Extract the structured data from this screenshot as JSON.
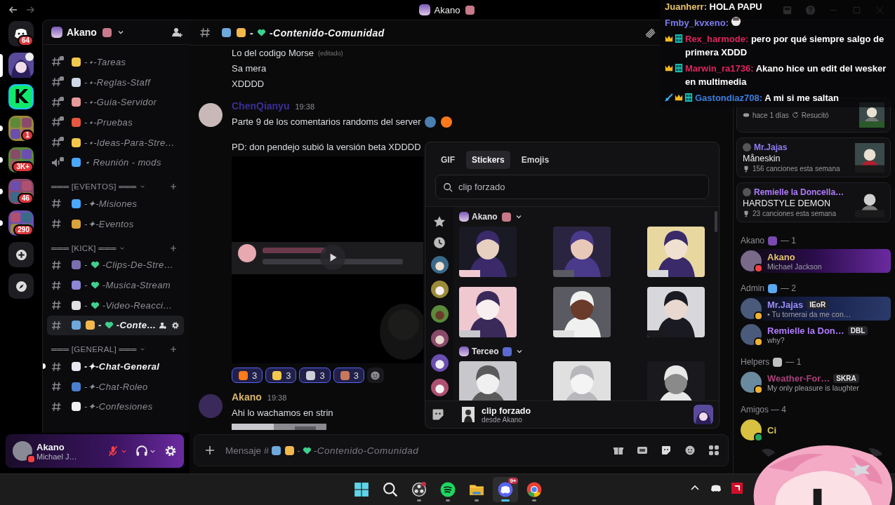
{
  "titlebar": {
    "title": "Akano",
    "title_emoji": {
      "color": "#c87a8a"
    }
  },
  "servers": [
    {
      "kind": "home",
      "badge": "64",
      "selected": false,
      "unread": false
    },
    {
      "kind": "server",
      "selected": true,
      "unread": false,
      "voice": true
    },
    {
      "kind": "logo",
      "letter": "K",
      "selected": false,
      "unread": false
    },
    {
      "kind": "folder",
      "badge": "1",
      "selected": false,
      "unread": true
    },
    {
      "kind": "folder",
      "badge": "3K+",
      "selected": false,
      "unread": true
    },
    {
      "kind": "folder",
      "badge": "46",
      "selected": false,
      "unread": true
    },
    {
      "kind": "folder",
      "badge": "290",
      "selected": false,
      "unread": true
    },
    {
      "kind": "add",
      "selected": false,
      "unread": false
    },
    {
      "kind": "discover",
      "selected": false,
      "unread": false
    }
  ],
  "channel_panel": {
    "server": "Akano",
    "server_emoji": {
      "color": "#c87a8a"
    },
    "items": [
      {
        "kind": "text",
        "locked": true,
        "emojis": [
          {
            "color": "#f2c94c"
          }
        ],
        "name": "-⋆-Tareas",
        "selected": false,
        "unread": false
      },
      {
        "kind": "text",
        "locked": true,
        "emojis": [
          {
            "color": "#cfd8e6"
          }
        ],
        "name": "-⋆-Reglas-Staff",
        "selected": false,
        "unread": false
      },
      {
        "kind": "text",
        "locked": true,
        "emojis": [
          {
            "color": "#e89a9a"
          }
        ],
        "name": "-⋆-Guia-Servidor",
        "selected": false,
        "unread": false
      },
      {
        "kind": "text",
        "locked": true,
        "emojis": [
          {
            "color": "#e8563f"
          }
        ],
        "name": "-⋆-Pruebas",
        "selected": false,
        "unread": false
      },
      {
        "kind": "text",
        "locked": true,
        "emojis": [
          {
            "color": "#f5c84a"
          }
        ],
        "name": "-⋆-Ideas-Para-Stre…",
        "selected": false,
        "unread": false
      },
      {
        "kind": "voice",
        "locked": true,
        "emojis": [
          {
            "color": "#4aa8ff"
          }
        ],
        "name": "⋆ Reunión - mods",
        "selected": false,
        "unread": false
      },
      {
        "kind": "category",
        "label": "═══ [EVENTOS] ═══"
      },
      {
        "kind": "text",
        "locked": false,
        "emojis": [
          {
            "color": "#4aa8ff"
          }
        ],
        "name": "-✦-Misiones",
        "selected": false,
        "unread": false
      },
      {
        "kind": "text",
        "locked": false,
        "emojis": [
          {
            "color": "#d9a23a"
          }
        ],
        "name": "-✦-Eventos",
        "selected": false,
        "unread": false
      },
      {
        "kind": "category",
        "label": "═══ [KICK] ═══"
      },
      {
        "kind": "text",
        "locked": false,
        "emojis": [
          {
            "color": "#7b6fb0"
          }
        ],
        "prefix": "-",
        "heart": true,
        "name": "-Clips-De-Stre…",
        "selected": false,
        "unread": false
      },
      {
        "kind": "text",
        "locked": false,
        "emojis": [
          {
            "color": "#8e86d8"
          }
        ],
        "prefix": "-",
        "heart": true,
        "name": "-Musica-Stream",
        "selected": false,
        "unread": false
      },
      {
        "kind": "text",
        "locked": false,
        "emojis": [
          {
            "color": "#e0e0e0"
          }
        ],
        "prefix": "-",
        "heart": true,
        "name": "-Video-Reacci…",
        "selected": false,
        "unread": false
      },
      {
        "kind": "text",
        "locked": false,
        "emojis": [
          {
            "color": "#6fa8dc"
          },
          {
            "color": "#f2b84b"
          }
        ],
        "prefix": "-",
        "heart": true,
        "name": "-Conte…",
        "selected": true,
        "unread": false
      },
      {
        "kind": "category",
        "label": "═══ [GENERAL] ═══"
      },
      {
        "kind": "text",
        "locked": false,
        "emojis": [
          {
            "color": "#e8e8f0"
          }
        ],
        "name": "-✦-Chat-General",
        "selected": false,
        "unread": true
      },
      {
        "kind": "text",
        "locked": false,
        "emojis": [
          {
            "color": "#4a7fd0"
          }
        ],
        "name": "-✦-Chat-Roleo",
        "selected": false,
        "unread": false
      },
      {
        "kind": "text",
        "locked": false,
        "emojis": [
          {
            "color": "#f0f0f0"
          }
        ],
        "name": "-✦-Confesiones",
        "selected": false,
        "unread": false
      }
    ]
  },
  "user_panel": {
    "name": "Akano",
    "activity": "Michael J…",
    "muted": true
  },
  "chat": {
    "header": {
      "emojis": [
        {
          "color": "#6fa8dc"
        },
        {
          "color": "#f2b84b"
        }
      ],
      "prefix": "-",
      "heart": true,
      "channel": "-Contenido-Comunidad"
    },
    "messages": [
      {
        "kind": "tail",
        "lines": [
          {
            "text": "Lo del codigo Morse",
            "note": "(editado)"
          },
          {
            "text": "Sa mera"
          },
          {
            "text": "XDDDD"
          }
        ]
      },
      {
        "kind": "message",
        "author": "ChenQianyu",
        "color": "#3b2f9a",
        "time": "19:38",
        "lines": [
          {
            "text": "Parte 9 de los comentarios randoms del server",
            "emojis": [
              {
                "color": "#4a7fb0"
              },
              {
                "color": "#ff7a1a"
              }
            ]
          },
          {
            "text": "PD: don pendejo subió la versión beta XDDDD",
            "gap": true
          }
        ],
        "video": true,
        "reactions": [
          {
            "emoji": {
              "color": "#ff7a1a"
            },
            "count": "3",
            "selected": true
          },
          {
            "emoji": {
              "color": "#f2c94c"
            },
            "count": "3",
            "selected": true
          },
          {
            "emoji": {
              "color": "#cfcfd8"
            },
            "count": "3",
            "selected": true
          },
          {
            "emoji": {
              "color": "#c8785a"
            },
            "count": "3",
            "selected": true
          }
        ]
      },
      {
        "kind": "message",
        "author": "Akano",
        "color": "#d9b46a",
        "time": "19:38",
        "lines": [
          {
            "text": "Ahi lo wachamos en strin"
          }
        ],
        "image": true
      }
    ],
    "composer": {
      "placeholder": "Mensaje #",
      "emojis": [
        {
          "color": "#6fa8dc"
        },
        {
          "color": "#f2b84b"
        }
      ],
      "prefix": "-",
      "heart": true,
      "channel": "-Contenido-Comunidad"
    }
  },
  "picker": {
    "tabs": [
      {
        "label": "GIF",
        "selected": false
      },
      {
        "label": "Stickers",
        "selected": true
      },
      {
        "label": "Emojis",
        "selected": false
      }
    ],
    "search": {
      "value": "clip forzado"
    },
    "packs": [
      {
        "kind": "favorites"
      },
      {
        "kind": "recent"
      },
      {
        "kind": "picture"
      },
      {
        "kind": "picture"
      },
      {
        "kind": "picture"
      },
      {
        "kind": "picture"
      },
      {
        "kind": "picture"
      },
      {
        "kind": "picture"
      }
    ],
    "sections": [
      {
        "name": "Akano",
        "emoji": {
          "color": "#c87a8a"
        },
        "expanded": true,
        "stickers": [
          {
            "kind": "picture"
          },
          {
            "kind": "picture"
          },
          {
            "kind": "picture"
          },
          {
            "kind": "picture"
          },
          {
            "kind": "picture"
          },
          {
            "kind": "picture"
          }
        ]
      },
      {
        "name": "Terceo",
        "emoji": {
          "color": "#5a6ad0"
        },
        "expanded": true,
        "stickers": [
          {
            "kind": "picture"
          },
          {
            "kind": "picture"
          },
          {
            "kind": "picture"
          }
        ]
      }
    ],
    "footer": {
      "name": "clip forzado",
      "source": "desde Akano"
    }
  },
  "members": {
    "cards": [
      {
        "kind": "game",
        "details": [
          "hace 1 días",
          "Resucitó"
        ]
      },
      {
        "kind": "music",
        "name": "Mr.Jajas",
        "color": "#8f7cf2",
        "title": "Måneskin",
        "detail": "156 canciones esta semana"
      },
      {
        "kind": "music",
        "name": "Remielle la Doncella…",
        "color": "#b07cff",
        "title": "HARDSTYLE DEMON",
        "detail": "23 canciones esta semana"
      }
    ],
    "groups": [
      {
        "label": "Akano",
        "emoji": {
          "color": "#7a4ab0"
        },
        "count": "— 1",
        "members": [
          {
            "name": "Akano",
            "color": "#e3c46b",
            "status": {
              "kind": "dnd"
            },
            "activity": "Michael Jackson",
            "banner": true
          }
        ]
      },
      {
        "label": "Admin",
        "emoji": {
          "color": "#5aa8f0"
        },
        "count": "— 2",
        "members": [
          {
            "name": "Mr.Jajas",
            "color": "#9a8cf5",
            "status": {
              "kind": "idle"
            },
            "tag": "IEoR",
            "activity": "• Tu tornerai da me con…",
            "banner": true
          },
          {
            "name": "Remielle la Don…",
            "color": "#b07cff",
            "status": {
              "kind": "idle"
            },
            "tag": "DBL",
            "activity": "why?",
            "banner": false
          }
        ]
      },
      {
        "label": "Helpers",
        "emoji": {
          "color": "#c0c0c0"
        },
        "count": "— 1",
        "members": [
          {
            "name": "Weather-For…",
            "color": "#a8407a",
            "status": {
              "kind": "idle"
            },
            "tag": "SKRA",
            "activity": "My only pleasure is laughter",
            "banner": false
          }
        ]
      },
      {
        "label": "Amigos",
        "count": "— 4",
        "members": [
          {
            "name": "Ci",
            "color": "#d8c85a",
            "status": {
              "kind": "online"
            },
            "banner": false
          }
        ]
      }
    ]
  },
  "stream_chat": [
    {
      "name": "Juanherr:",
      "color": "#e8c06a",
      "text": "HOLA PAPU"
    },
    {
      "name": "Fmby_kvxeno:",
      "color": "#7d7cf0",
      "emote": true
    },
    {
      "badges": [
        {
          "kind": "crown"
        },
        {
          "kind": "grid"
        }
      ],
      "name": "Rex_harmode:",
      "color": "#e0245e",
      "text": "pero por qué siempre salgo de primera XDDD"
    },
    {
      "badges": [
        {
          "kind": "crown"
        },
        {
          "kind": "grid"
        }
      ],
      "name": "Marwin_ra1736:",
      "color": "#e0245e",
      "text": "Akano hice un edit del wesker en multimedia"
    },
    {
      "badges": [
        {
          "kind": "sword"
        },
        {
          "kind": "crown"
        },
        {
          "kind": "grid"
        }
      ],
      "name": "Gastondiaz708:",
      "color": "#3d7fe0",
      "text": "A mi si me saltan"
    }
  ],
  "taskbar": {
    "apps": [
      {
        "kind": "start",
        "running": false
      },
      {
        "kind": "search",
        "running": false
      },
      {
        "kind": "obs",
        "running": true,
        "alert": true
      },
      {
        "kind": "spotify",
        "running": true
      },
      {
        "kind": "files",
        "running": true
      },
      {
        "kind": "discord",
        "running": true,
        "selected": true,
        "badge": "9+"
      },
      {
        "kind": "chrome",
        "running": true
      }
    ],
    "tray": [
      {
        "kind": "chevron"
      },
      {
        "kind": "discord"
      },
      {
        "kind": "amd"
      }
    ]
  }
}
